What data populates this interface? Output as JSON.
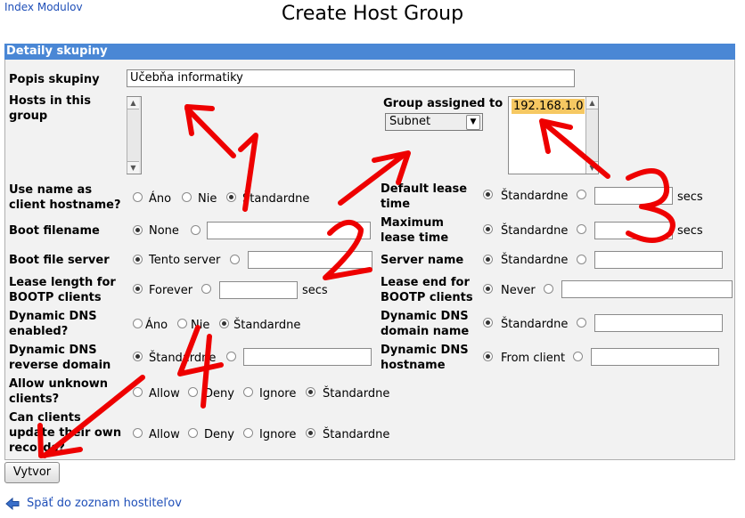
{
  "nav": {
    "index_link": "Index Modulov",
    "back_link": "Späť do zoznam hostiteľov"
  },
  "page": {
    "title": "Create Host Group"
  },
  "section": {
    "header": "Detaily skupiny"
  },
  "form": {
    "description_label": "Popis skupiny",
    "description_value": "Učebňa informatiky",
    "hosts_label": "Hosts in this group",
    "assigned_label": "Group assigned to",
    "assigned_select": "Subnet",
    "assigned_list": [
      "192.168.1.0"
    ],
    "use_name_label": "Use name as client hostname?",
    "use_name_options": [
      "Áno",
      "Nie",
      "Štandardne"
    ],
    "boot_filename_label": "Boot filename",
    "boot_filename_none": "None",
    "boot_server_label": "Boot file server",
    "boot_server_option": "Tento server",
    "lease_bootp_label": "Lease length for BOOTP clients",
    "lease_bootp_option": "Forever",
    "secs": "secs",
    "ddns_enabled_label": "Dynamic DNS enabled?",
    "ddns_enabled_options": [
      "Áno",
      "Nie",
      "Štandardne"
    ],
    "ddns_reverse_label": "Dynamic DNS reverse domain",
    "standard": "Štandardne",
    "allow_unknown_label": "Allow unknown clients?",
    "client_update_label": "Can clients update their own records?",
    "allow_options": [
      "Allow",
      "Deny",
      "Ignore",
      "Štandardne"
    ],
    "default_lease_label": "Default lease time",
    "max_lease_label": "Maximum lease time",
    "server_name_label": "Server name",
    "lease_end_label": "Lease end for BOOTP clients",
    "lease_end_option": "Never",
    "ddns_domain_label": "Dynamic DNS domain name",
    "ddns_hostname_label": "Dynamic DNS hostname",
    "ddns_hostname_option": "From client",
    "create_button": "Vytvor"
  },
  "annotations": {
    "numbers": [
      "1",
      "2",
      "3",
      "4"
    ],
    "color": "#ee0000"
  },
  "colors": {
    "header_bg": "#4a87d5",
    "panel_bg": "#f2f2f2",
    "selected_item": "#f6c862"
  }
}
